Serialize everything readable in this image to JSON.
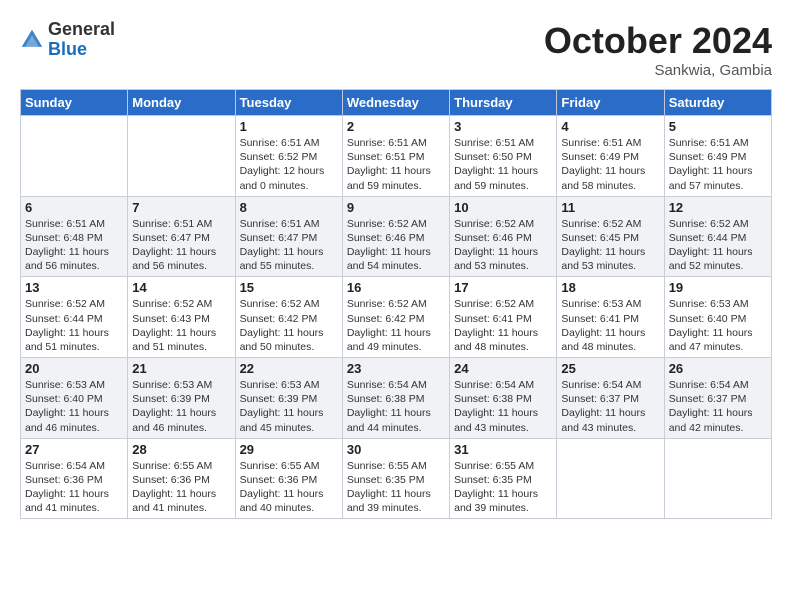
{
  "logo": {
    "general": "General",
    "blue": "Blue"
  },
  "header": {
    "month": "October 2024",
    "location": "Sankwia, Gambia"
  },
  "days_of_week": [
    "Sunday",
    "Monday",
    "Tuesday",
    "Wednesday",
    "Thursday",
    "Friday",
    "Saturday"
  ],
  "weeks": [
    [
      {
        "day": null,
        "info": null
      },
      {
        "day": null,
        "info": null
      },
      {
        "day": "1",
        "info": "Sunrise: 6:51 AM\nSunset: 6:52 PM\nDaylight: 12 hours\nand 0 minutes."
      },
      {
        "day": "2",
        "info": "Sunrise: 6:51 AM\nSunset: 6:51 PM\nDaylight: 11 hours\nand 59 minutes."
      },
      {
        "day": "3",
        "info": "Sunrise: 6:51 AM\nSunset: 6:50 PM\nDaylight: 11 hours\nand 59 minutes."
      },
      {
        "day": "4",
        "info": "Sunrise: 6:51 AM\nSunset: 6:49 PM\nDaylight: 11 hours\nand 58 minutes."
      },
      {
        "day": "5",
        "info": "Sunrise: 6:51 AM\nSunset: 6:49 PM\nDaylight: 11 hours\nand 57 minutes."
      }
    ],
    [
      {
        "day": "6",
        "info": "Sunrise: 6:51 AM\nSunset: 6:48 PM\nDaylight: 11 hours\nand 56 minutes."
      },
      {
        "day": "7",
        "info": "Sunrise: 6:51 AM\nSunset: 6:47 PM\nDaylight: 11 hours\nand 56 minutes."
      },
      {
        "day": "8",
        "info": "Sunrise: 6:51 AM\nSunset: 6:47 PM\nDaylight: 11 hours\nand 55 minutes."
      },
      {
        "day": "9",
        "info": "Sunrise: 6:52 AM\nSunset: 6:46 PM\nDaylight: 11 hours\nand 54 minutes."
      },
      {
        "day": "10",
        "info": "Sunrise: 6:52 AM\nSunset: 6:46 PM\nDaylight: 11 hours\nand 53 minutes."
      },
      {
        "day": "11",
        "info": "Sunrise: 6:52 AM\nSunset: 6:45 PM\nDaylight: 11 hours\nand 53 minutes."
      },
      {
        "day": "12",
        "info": "Sunrise: 6:52 AM\nSunset: 6:44 PM\nDaylight: 11 hours\nand 52 minutes."
      }
    ],
    [
      {
        "day": "13",
        "info": "Sunrise: 6:52 AM\nSunset: 6:44 PM\nDaylight: 11 hours\nand 51 minutes."
      },
      {
        "day": "14",
        "info": "Sunrise: 6:52 AM\nSunset: 6:43 PM\nDaylight: 11 hours\nand 51 minutes."
      },
      {
        "day": "15",
        "info": "Sunrise: 6:52 AM\nSunset: 6:42 PM\nDaylight: 11 hours\nand 50 minutes."
      },
      {
        "day": "16",
        "info": "Sunrise: 6:52 AM\nSunset: 6:42 PM\nDaylight: 11 hours\nand 49 minutes."
      },
      {
        "day": "17",
        "info": "Sunrise: 6:52 AM\nSunset: 6:41 PM\nDaylight: 11 hours\nand 48 minutes."
      },
      {
        "day": "18",
        "info": "Sunrise: 6:53 AM\nSunset: 6:41 PM\nDaylight: 11 hours\nand 48 minutes."
      },
      {
        "day": "19",
        "info": "Sunrise: 6:53 AM\nSunset: 6:40 PM\nDaylight: 11 hours\nand 47 minutes."
      }
    ],
    [
      {
        "day": "20",
        "info": "Sunrise: 6:53 AM\nSunset: 6:40 PM\nDaylight: 11 hours\nand 46 minutes."
      },
      {
        "day": "21",
        "info": "Sunrise: 6:53 AM\nSunset: 6:39 PM\nDaylight: 11 hours\nand 46 minutes."
      },
      {
        "day": "22",
        "info": "Sunrise: 6:53 AM\nSunset: 6:39 PM\nDaylight: 11 hours\nand 45 minutes."
      },
      {
        "day": "23",
        "info": "Sunrise: 6:54 AM\nSunset: 6:38 PM\nDaylight: 11 hours\nand 44 minutes."
      },
      {
        "day": "24",
        "info": "Sunrise: 6:54 AM\nSunset: 6:38 PM\nDaylight: 11 hours\nand 43 minutes."
      },
      {
        "day": "25",
        "info": "Sunrise: 6:54 AM\nSunset: 6:37 PM\nDaylight: 11 hours\nand 43 minutes."
      },
      {
        "day": "26",
        "info": "Sunrise: 6:54 AM\nSunset: 6:37 PM\nDaylight: 11 hours\nand 42 minutes."
      }
    ],
    [
      {
        "day": "27",
        "info": "Sunrise: 6:54 AM\nSunset: 6:36 PM\nDaylight: 11 hours\nand 41 minutes."
      },
      {
        "day": "28",
        "info": "Sunrise: 6:55 AM\nSunset: 6:36 PM\nDaylight: 11 hours\nand 41 minutes."
      },
      {
        "day": "29",
        "info": "Sunrise: 6:55 AM\nSunset: 6:36 PM\nDaylight: 11 hours\nand 40 minutes."
      },
      {
        "day": "30",
        "info": "Sunrise: 6:55 AM\nSunset: 6:35 PM\nDaylight: 11 hours\nand 39 minutes."
      },
      {
        "day": "31",
        "info": "Sunrise: 6:55 AM\nSunset: 6:35 PM\nDaylight: 11 hours\nand 39 minutes."
      },
      {
        "day": null,
        "info": null
      },
      {
        "day": null,
        "info": null
      }
    ]
  ]
}
